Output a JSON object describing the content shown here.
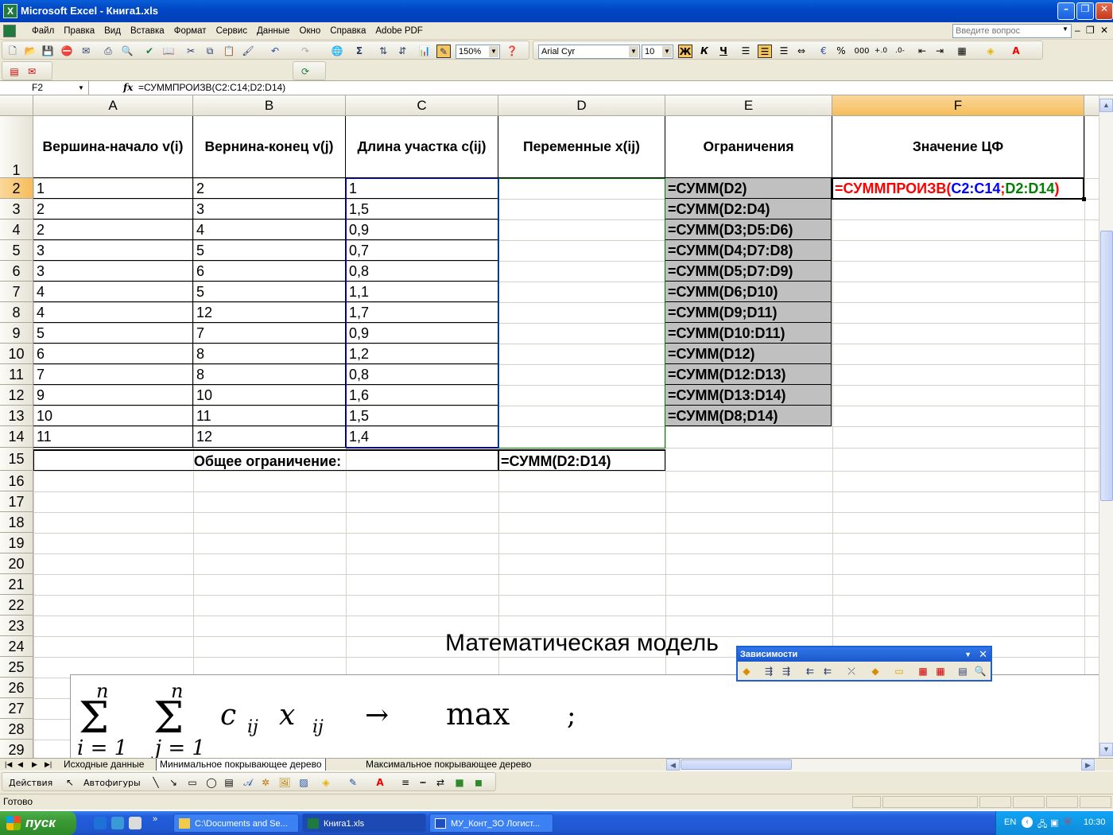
{
  "window": {
    "title": "Microsoft Excel - Книга1.xls"
  },
  "menu": {
    "items": [
      "Файл",
      "Правка",
      "Вид",
      "Вставка",
      "Формат",
      "Сервис",
      "Данные",
      "Окно",
      "Справка",
      "Adobe PDF"
    ],
    "ask_placeholder": "Введите вопрос"
  },
  "toolbar": {
    "zoom": "150%",
    "font": "Arial Cyr",
    "font_size": "10",
    "bold": "Ж",
    "italic": "К",
    "underline": "Ч",
    "percent": "%",
    "thousands": "000"
  },
  "formula_bar": {
    "name_box": "F2",
    "fx": "fx",
    "formula": "=СУММПРОИЗВ(C2:C14;D2:D14)"
  },
  "columns": [
    "A",
    "B",
    "C",
    "D",
    "E",
    "F"
  ],
  "rows": [
    "1",
    "2",
    "3",
    "4",
    "5",
    "6",
    "7",
    "8",
    "9",
    "10",
    "11",
    "12",
    "13",
    "14",
    "15",
    "16",
    "17",
    "18",
    "19",
    "20",
    "21",
    "22",
    "23",
    "24",
    "25",
    "26",
    "27",
    "28",
    "29"
  ],
  "headers": {
    "a": "Вершина-начало v(i)",
    "b": "Вернина-конец v(j)",
    "c": "Длина участка c(ij)",
    "d": "Переменные x(ij)",
    "e": "Ограничения",
    "f": "Значение ЦФ"
  },
  "data": [
    {
      "a": "1",
      "b": "2",
      "c": "1",
      "e": "=СУММ(D2)"
    },
    {
      "a": "2",
      "b": "3",
      "c": "1,5",
      "e": "=СУММ(D2:D4)"
    },
    {
      "a": "2",
      "b": "4",
      "c": "0,9",
      "e": "=СУММ(D3;D5:D6)"
    },
    {
      "a": "3",
      "b": "5",
      "c": "0,7",
      "e": "=СУММ(D4;D7:D8)"
    },
    {
      "a": "3",
      "b": "6",
      "c": "0,8",
      "e": "=СУММ(D5;D7:D9)"
    },
    {
      "a": "4",
      "b": "5",
      "c": "1,1",
      "e": "=СУММ(D6;D10)"
    },
    {
      "a": "4",
      "b": "12",
      "c": "1,7",
      "e": "=СУММ(D9;D11)"
    },
    {
      "a": "5",
      "b": "7",
      "c": "0,9",
      "e": "=СУММ(D10:D11)"
    },
    {
      "a": "6",
      "b": "8",
      "c": "1,2",
      "e": "=СУММ(D12)"
    },
    {
      "a": "7",
      "b": "8",
      "c": "0,8",
      "e": "=СУММ(D12:D13)"
    },
    {
      "a": "9",
      "b": "10",
      "c": "1,6",
      "e": "=СУММ(D13:D14)"
    },
    {
      "a": "10",
      "b": "11",
      "c": "1,5",
      "e": "=СУММ(D8;D14)"
    },
    {
      "a": "11",
      "b": "12",
      "c": "1,4",
      "e": ""
    }
  ],
  "f2_formula": {
    "prefix": "=СУММПРОИЗВ(",
    "range1": "C2:C14",
    "sep": ";",
    "range2": "D2:D14",
    "suffix": ")"
  },
  "row15": {
    "label": "Общее ограничение:",
    "formula": "=СУММ(D2:D14)"
  },
  "heading": "Математическая модель",
  "math": {
    "sum1_top": "n",
    "sum1_bottom": "i = 1",
    "sum2_top": "n",
    "sum2_bottom": "j = 1",
    "c": "c",
    "c_sub": "ij",
    "x": "x",
    "x_sub": "ij",
    "arrow": "→",
    "max": "max",
    "semi": ";"
  },
  "deps_toolbar": {
    "title": "Зависимости"
  },
  "sheet_tabs": [
    "Исходные данные",
    "Минимальное покрывающее дерево",
    "Максимальное покрывающее дерево"
  ],
  "active_tab": 1,
  "draw_toolbar": {
    "actions": "Действия",
    "autoshapes": "Автофигуры"
  },
  "status": {
    "text": "Готово"
  },
  "taskbar": {
    "start": "пуск",
    "tasks": [
      "C:\\Documents and Se...",
      "Книга1.xls",
      "МУ_Конт_ЗО Логист..."
    ],
    "lang": "EN",
    "clock": "10:30"
  },
  "colors": {
    "accent": "#0a5fd8",
    "ref_blue": "#0000ff",
    "ref_green": "#008000",
    "formula_red": "#ff0000",
    "gray_fill": "#c0c0c0",
    "selected_header": "#f5bd5b"
  }
}
